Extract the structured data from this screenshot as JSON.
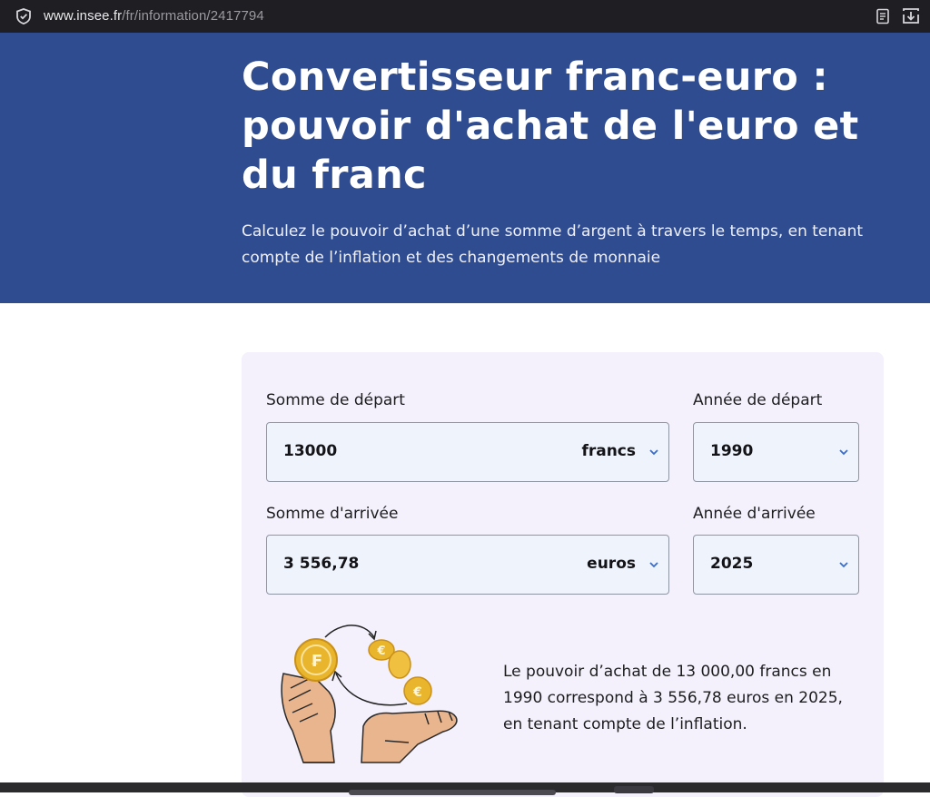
{
  "browser": {
    "url_host": "www.insee.fr",
    "url_path": "/fr/information/2417794",
    "icons": [
      "shield-icon",
      "reader-view-icon",
      "download-icon"
    ]
  },
  "hero": {
    "title": "Convertisseur franc-euro : pouvoir d'achat de l'euro et du franc",
    "subtitle": "Calculez le pouvoir d’achat d’une somme d’argent à travers le temps, en tenant compte de l’inflation et des changements de monnaie"
  },
  "converter": {
    "start_amount": {
      "label": "Somme de départ",
      "value": "13000",
      "currency": "francs"
    },
    "start_year": {
      "label": "Année de départ",
      "value": "1990"
    },
    "end_amount": {
      "label": "Somme d'arrivée",
      "value": "3 556,78",
      "currency": "euros"
    },
    "end_year": {
      "label": "Année d'arrivée",
      "value": "2025"
    }
  },
  "result_text": "Le pouvoir d’achat de 13 000,00 francs en 1990 correspond à 3 556,78 euros en 2025, en tenant compte de l’inflation.",
  "colors": {
    "hero_bg": "#304c91",
    "card_bg": "#f4f1fc",
    "field_bg": "#eff4fc",
    "chevron": "#3a6cc8",
    "coin": "#e9b52c"
  }
}
